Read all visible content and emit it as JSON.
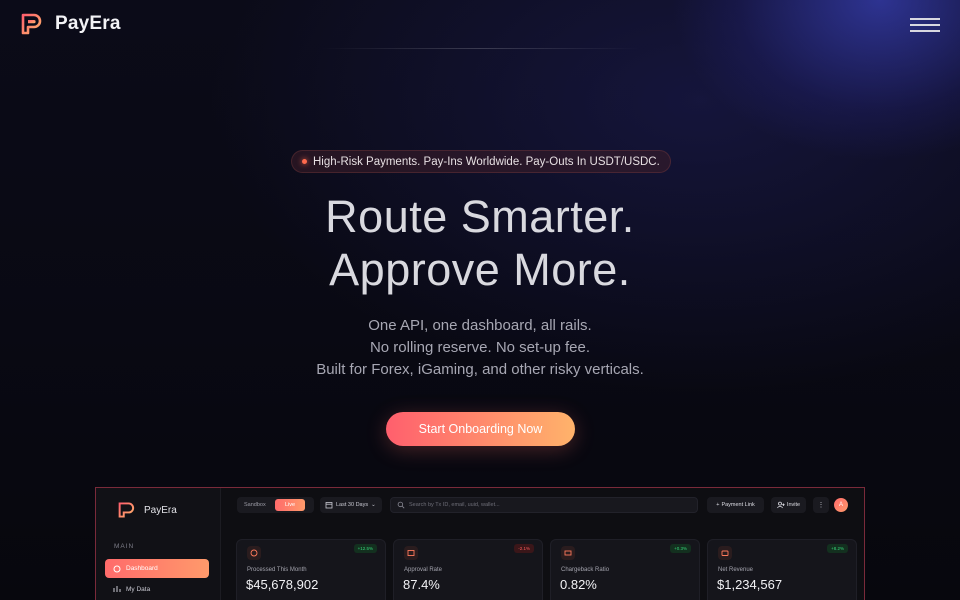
{
  "header": {
    "brand": "PayEra",
    "menu_icon": "hamburger-menu-icon"
  },
  "hero": {
    "badge": "High-Risk Payments. Pay-Ins Worldwide. Pay-Outs In USDT/USDC.",
    "title_line1": "Route Smarter.",
    "title_line2": "Approve More.",
    "subtitle": [
      "One API, one dashboard, all rails.",
      "No rolling reserve. No set-up fee.",
      "Built for Forex, iGaming, and other risky verticals."
    ],
    "cta_label": "Start Onboarding Now"
  },
  "dashboard_preview": {
    "brand": "PayEra",
    "sidebar": {
      "section": "MAIN",
      "items": [
        {
          "label": "Dashboard",
          "icon": "dashboard-icon",
          "active": true
        },
        {
          "label": "My Data",
          "icon": "chart-icon",
          "active": false
        }
      ]
    },
    "toolbar": {
      "env_off": "Sandbox",
      "env_on": "Live",
      "range": "Last 30 Days",
      "search_placeholder": "Search by Tx ID, email, uuid, wallet...",
      "payment_link": "Payment Link",
      "invite": "Invite",
      "more": "⋮",
      "avatar_initial": "A"
    },
    "cards": [
      {
        "label": "Processed This Month",
        "value": "$45,678,902",
        "chip": "+12.5%",
        "trend": "up",
        "icon": "coin-icon"
      },
      {
        "label": "Approval Rate",
        "value": "87.4%",
        "chip": "-2.1%",
        "trend": "down",
        "icon": "approval-icon"
      },
      {
        "label": "Chargeback Ratio",
        "value": "0.82%",
        "chip": "+0.3%",
        "trend": "up",
        "icon": "chargeback-icon"
      },
      {
        "label": "Net Revenue",
        "value": "$1,234,567",
        "chip": "+8.2%",
        "trend": "up",
        "icon": "wallet-icon"
      }
    ]
  },
  "colors": {
    "accent_start": "#ff5f6d",
    "accent_end": "#ffb36b",
    "background": "#09090f",
    "positive": "#37d67a",
    "negative": "#ff5c5c"
  }
}
